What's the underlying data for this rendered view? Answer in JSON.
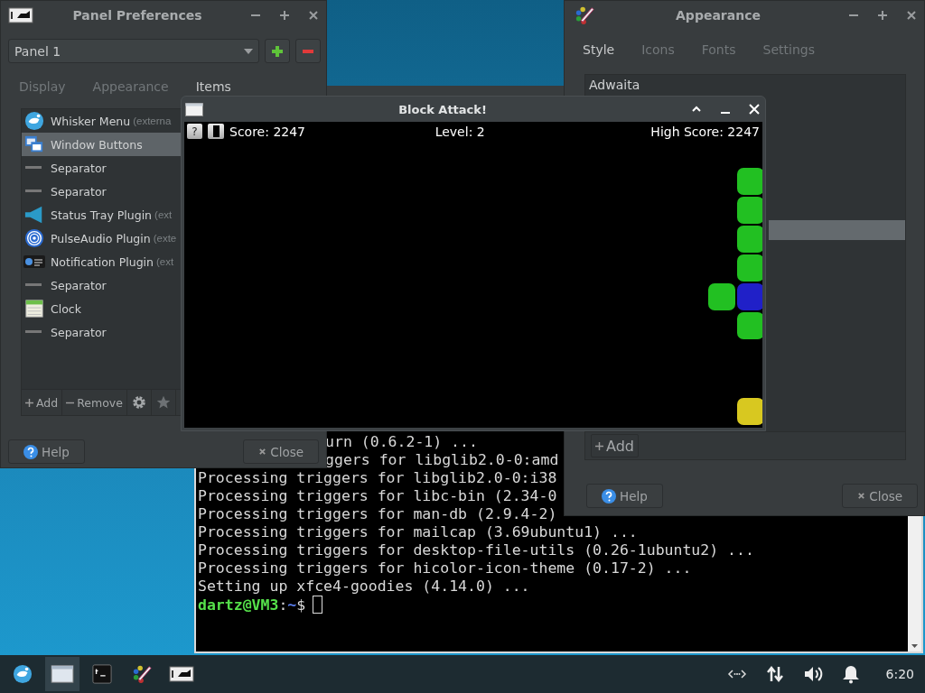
{
  "terminal": {
    "lines": [
      {
        "text": "urn (0.6.2-1) ...",
        "kind": "clipped"
      },
      {
        "text": "ggers for libglib2.0-0:amd",
        "kind": "clipped"
      },
      {
        "text": "Processing triggers for libglib2.0-0:i38",
        "kind": "full"
      },
      {
        "text": "Processing triggers for libc-bin (2.34-0",
        "kind": "full"
      },
      {
        "text": "Processing triggers for man-db (2.9.4-2)",
        "kind": "full"
      },
      {
        "text": "Processing triggers for mailcap (3.69ubuntu1) ...",
        "kind": "full"
      },
      {
        "text": "Processing triggers for desktop-file-utils (0.26-1ubuntu2) ...",
        "kind": "full"
      },
      {
        "text": "Processing triggers for hicolor-icon-theme (0.17-2) ...",
        "kind": "full"
      },
      {
        "text": "Setting up xfce4-goodies (4.14.0) ..."
      }
    ],
    "prompt": {
      "user": "dartz@VM3",
      "sep": ":",
      "path": "~",
      "symbol": "$"
    }
  },
  "panel_preferences": {
    "title": "Panel Preferences",
    "panel_select": {
      "value": "Panel 1"
    },
    "tabs": [
      {
        "label": "Display",
        "selected": false
      },
      {
        "label": "Appearance",
        "selected": false
      },
      {
        "label": "Items",
        "selected": true
      }
    ],
    "items": [
      {
        "name": "Whisker Menu",
        "note": "(externa",
        "kind": "whisker",
        "selected": false
      },
      {
        "name": "Window Buttons",
        "kind": "windows",
        "selected": true
      },
      {
        "name": "Separator",
        "kind": "separator",
        "selected": false
      },
      {
        "name": "Separator",
        "kind": "separator",
        "selected": false
      },
      {
        "name": "Status Tray Plugin",
        "note": "(ext",
        "kind": "tray",
        "selected": false
      },
      {
        "name": "PulseAudio Plugin",
        "note": "(exte",
        "kind": "audio",
        "selected": false
      },
      {
        "name": "Notification Plugin",
        "note": "(ext",
        "kind": "notification",
        "selected": false
      },
      {
        "name": "Separator",
        "kind": "separator",
        "selected": false
      },
      {
        "name": "Clock",
        "kind": "clock",
        "selected": false
      },
      {
        "name": "Separator",
        "kind": "separator",
        "selected": false
      }
    ],
    "add": "Add",
    "remove": "Remove",
    "help": "Help",
    "close": "Close"
  },
  "appearance": {
    "title": "Appearance",
    "tabs": [
      {
        "label": "Style",
        "selected": true
      },
      {
        "label": "Icons",
        "selected": false
      },
      {
        "label": "Fonts",
        "selected": false
      },
      {
        "label": "Settings",
        "selected": false
      }
    ],
    "themes": [
      {
        "label": "Adwaita",
        "selected": false
      },
      {
        "selected": true
      }
    ],
    "add": "Add",
    "help": "Help",
    "close": "Close"
  },
  "block_attack": {
    "title": "Block Attack!",
    "help_key": "?",
    "score": "Score: 2247",
    "level": "Level: 2",
    "high_score": "High Score: 2247"
  },
  "taskbar": {
    "tasks": [
      {
        "kind": "window",
        "selected": true
      },
      {
        "kind": "terminal",
        "selected": false
      },
      {
        "kind": "palette",
        "selected": false
      },
      {
        "kind": "panel",
        "selected": false
      }
    ],
    "clock": "6:20"
  }
}
